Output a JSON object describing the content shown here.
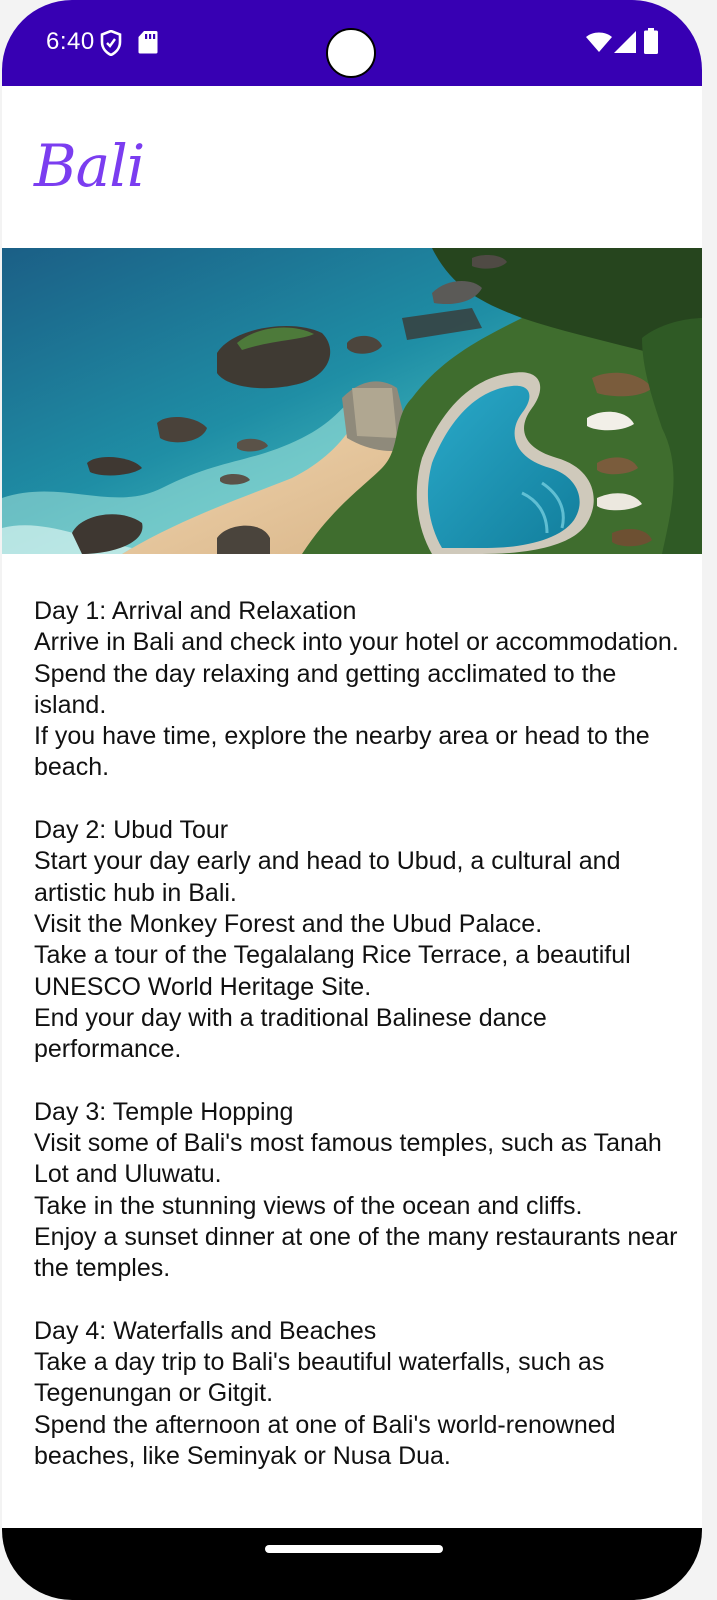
{
  "status_bar": {
    "time": "6:40",
    "left_icons": [
      "shield-icon",
      "sd-card-icon"
    ],
    "right_icons": [
      "wifi-icon",
      "signal-icon",
      "battery-icon"
    ],
    "background": "#3700b3"
  },
  "app_bar": {
    "title": "Bali",
    "title_color": "#7b3df0"
  },
  "hero_image": {
    "subject": "beach-resort-photo"
  },
  "itinerary": [
    {
      "heading": "Day 1: Arrival and Relaxation",
      "lines": [
        "Arrive in Bali and check into your hotel or accommodation.",
        "Spend the day relaxing and getting acclimated to the island.",
        "If you have time, explore the nearby area or head to the beach."
      ]
    },
    {
      "heading": "Day 2: Ubud Tour",
      "lines": [
        "Start your day early and head to Ubud, a cultural and artistic hub in Bali.",
        "Visit the Monkey Forest and the Ubud Palace.",
        "Take a tour of the Tegalalang Rice Terrace, a beautiful UNESCO World Heritage Site.",
        "End your day with a traditional Balinese dance performance."
      ]
    },
    {
      "heading": "Day 3: Temple Hopping",
      "lines": [
        "Visit some of Bali's most famous temples, such as Tanah Lot and Uluwatu.",
        "Take in the stunning views of the ocean and cliffs.",
        "Enjoy a sunset dinner at one of the many restaurants near the temples."
      ]
    },
    {
      "heading": "Day 4: Waterfalls and Beaches",
      "lines": [
        "Take a day trip to Bali's beautiful waterfalls, such as Tegenungan or Gitgit.",
        "Spend the afternoon at one of Bali's world-renowned beaches, like Seminyak or Nusa Dua."
      ]
    }
  ],
  "nav_bar": {
    "handle": "home-gesture-handle"
  }
}
